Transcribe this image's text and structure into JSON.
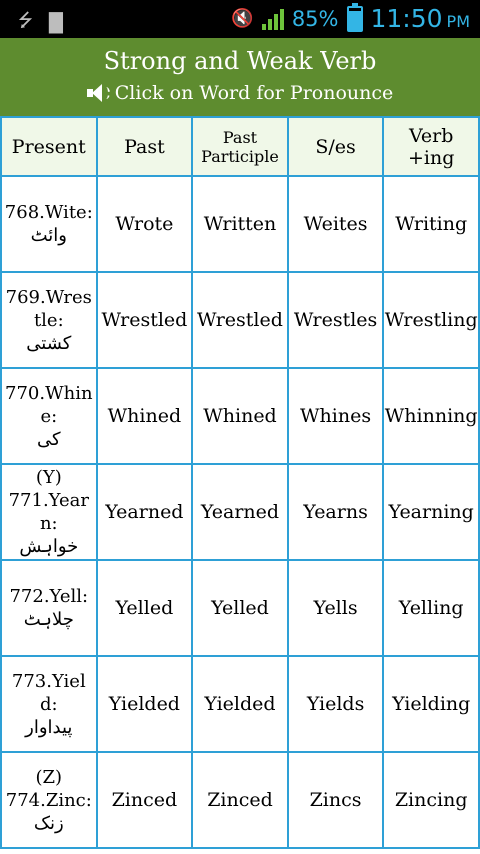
{
  "status_bar": {
    "battery_percent": "85%",
    "time": "11:50",
    "ampm": "PM",
    "accent_color": "#33b5e5"
  },
  "header": {
    "title": "Strong and Weak Verb",
    "subtitle": "Click on Word for Pronounce",
    "background": "#5e8c2f"
  },
  "columns": [
    "Present",
    "Past",
    "Past Participle",
    "S/es",
    "Verb +ing"
  ],
  "rows": [
    {
      "pre": "",
      "present": "768.Wite:",
      "urdu": "وائٹ",
      "past": "Wrote",
      "participle": "Written",
      "ses": "Weites",
      "ing": "Writing"
    },
    {
      "pre": "",
      "present": "769.Wrestle:",
      "urdu": "کشتی",
      "past": "Wrestled",
      "participle": "Wrestled",
      "ses": "Wrestles",
      "ing": "Wrestling"
    },
    {
      "pre": "",
      "present": "770.Whine:",
      "urdu": "کی",
      "past": "Whined",
      "participle": "Whined",
      "ses": "Whines",
      "ing": "Whinning"
    },
    {
      "pre": "(Y)",
      "present": "771.Yearn:",
      "urdu": "خواہش",
      "past": "Yearned",
      "participle": "Yearned",
      "ses": "Yearns",
      "ing": "Yearning"
    },
    {
      "pre": "",
      "present": "772.Yell:",
      "urdu": "چلاہٹ",
      "past": "Yelled",
      "participle": "Yelled",
      "ses": "Yells",
      "ing": "Yelling"
    },
    {
      "pre": "",
      "present": "773.Yield:",
      "urdu": "پیداوار",
      "past": "Yielded",
      "participle": "Yielded",
      "ses": "Yields",
      "ing": "Yielding"
    },
    {
      "pre": "(Z)",
      "present": "774.Zinc:",
      "urdu": "زنک",
      "past": "Zinced",
      "participle": "Zinced",
      "ses": "Zincs",
      "ing": "Zincing"
    }
  ]
}
